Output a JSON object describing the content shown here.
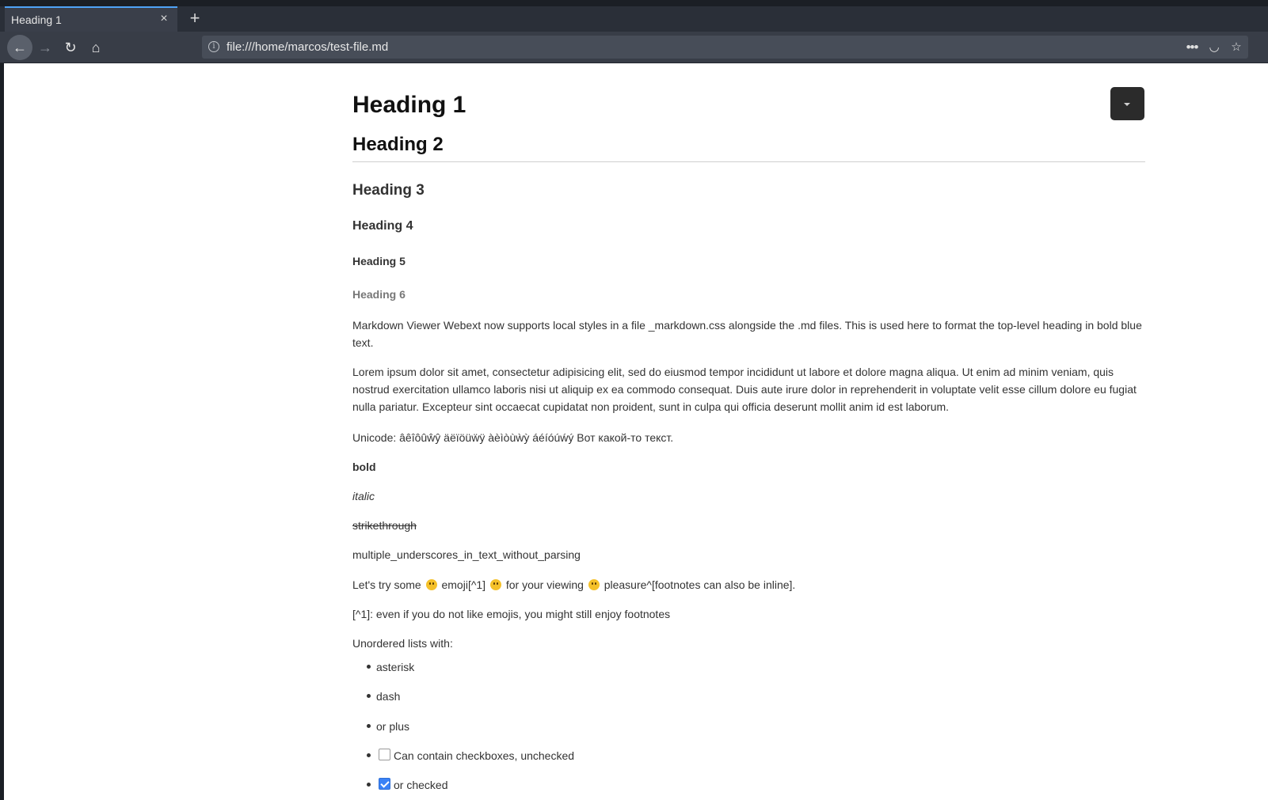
{
  "browser": {
    "tab": {
      "title": "Heading 1",
      "close_label": "×"
    },
    "new_tab_label": "+",
    "url": "file:///home/marcos/test-file.md",
    "icons": {
      "back": "back-arrow-icon",
      "forward": "forward-arrow-icon",
      "reload": "reload-icon",
      "home": "home-icon",
      "info": "info-icon",
      "more": "more-icon",
      "pocket": "pocket-icon",
      "star": "bookmark-star-icon"
    },
    "glyphs": {
      "back": "←",
      "forward": "→",
      "reload": "↻",
      "home": "⌂",
      "info": "i",
      "more": "•••",
      "pocket": "◡",
      "star": "☆"
    }
  },
  "document": {
    "h1": "Heading 1",
    "h2": "Heading 2",
    "h3": "Heading 3",
    "h4": "Heading 4",
    "h5": "Heading 5",
    "h6": "Heading 6",
    "p1": "Markdown Viewer Webext now supports local styles in a file _markdown.css alongside the .md files. This is used here to format the top-level heading in bold blue text.",
    "p2": "Lorem ipsum dolor sit amet, consectetur adipisicing elit, sed do eiusmod tempor incididunt ut labore et dolore magna aliqua. Ut enim ad minim veniam, quis nostrud exercitation ullamco laboris nisi ut aliquip ex ea commodo consequat. Duis aute irure dolor in reprehenderit in voluptate velit esse cillum dolore eu fugiat nulla pariatur. Excepteur sint occaecat cupidatat non proident, sunt in culpa qui officia deserunt mollit anim id est laborum.",
    "unicode": "Unicode: âêîôûŵŷ äëïöüẅÿ àèìòùẁỳ áéíóúẃý Вот какой-то текст.",
    "bold": "bold",
    "italic": "italic",
    "strike": "strikethrough",
    "underscores": "multiple_underscores_in_text_without_parsing",
    "emoji_line": {
      "part1": "Let's try some",
      "part2": "emoji[^1]",
      "part3": "for your viewing",
      "part4": "pleasure^[footnotes can also be inline]."
    },
    "footnote": "[^1]: even if you do not like emojis, you might still enjoy footnotes",
    "unordered_intro": "Unordered lists with:",
    "list": [
      {
        "text": "asterisk"
      },
      {
        "text": "dash"
      },
      {
        "text": "or plus"
      },
      {
        "text": "Can contain checkboxes, unchecked",
        "checked": false
      },
      {
        "text": "or checked",
        "checked": true
      }
    ],
    "accent_color": "#3a82f6"
  }
}
